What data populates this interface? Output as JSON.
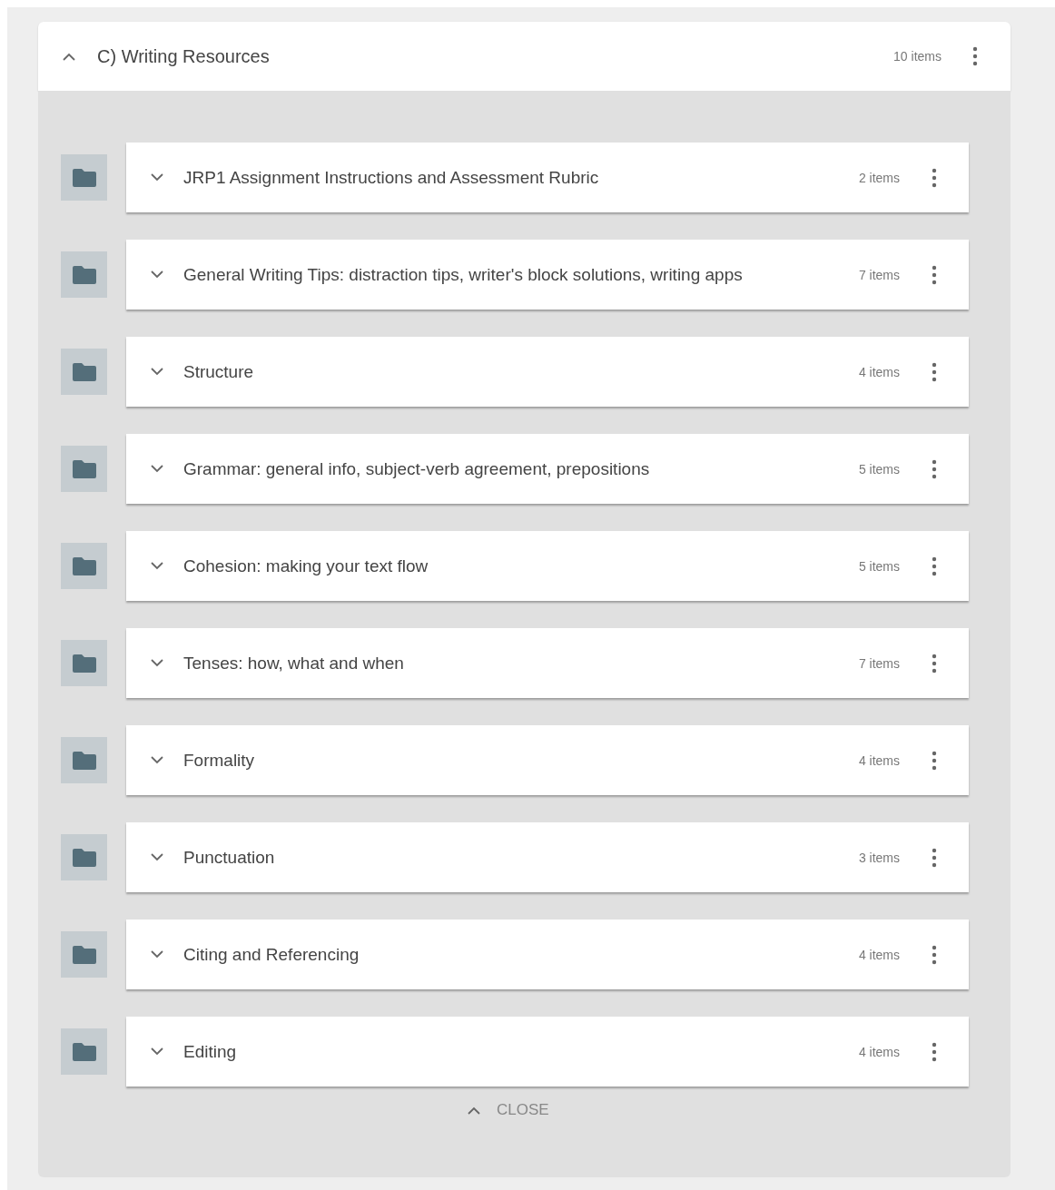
{
  "section": {
    "title": "C) Writing Resources",
    "count": "10 items",
    "expanded": true,
    "folders": [
      {
        "title": "JRP1 Assignment Instructions and Assessment Rubric",
        "count": "2 items",
        "expanded": false
      },
      {
        "title": "General Writing Tips: distraction tips, writer's block solutions, writing apps",
        "count": "7 items",
        "expanded": false
      },
      {
        "title": "Structure",
        "count": "4 items",
        "expanded": false
      },
      {
        "title": "Grammar: general info, subject-verb agreement, prepositions",
        "count": "5 items",
        "expanded": false
      },
      {
        "title": "Cohesion: making your text flow",
        "count": "5 items",
        "expanded": false
      },
      {
        "title": "Tenses: how, what and when",
        "count": "7 items",
        "expanded": false
      },
      {
        "title": "Formality",
        "count": "4 items",
        "expanded": false
      },
      {
        "title": "Punctuation",
        "count": "3 items",
        "expanded": false
      },
      {
        "title": "Citing and Referencing",
        "count": "4 items",
        "expanded": false
      },
      {
        "title": "Editing",
        "count": "4 items",
        "expanded": false
      }
    ],
    "close_label": "CLOSE"
  }
}
